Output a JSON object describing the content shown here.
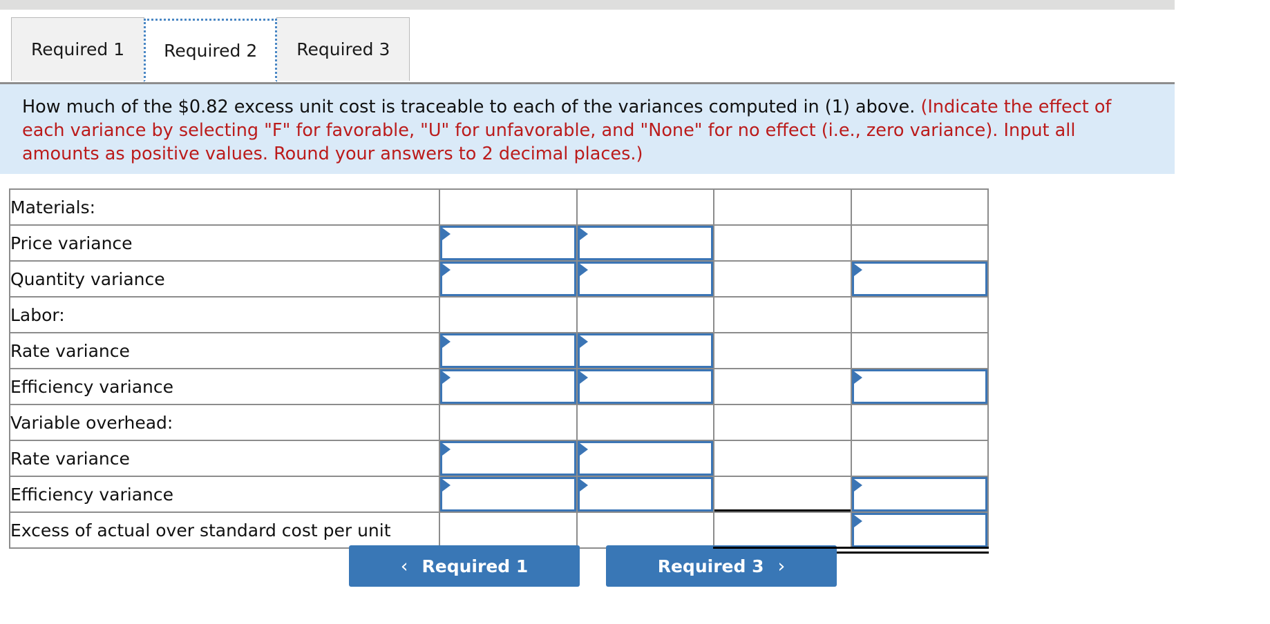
{
  "tabs": [
    {
      "label": "Required 1",
      "active": false
    },
    {
      "label": "Required 2",
      "active": true
    },
    {
      "label": "Required 3",
      "active": false
    }
  ],
  "instructions": {
    "black_part": "How much of the $0.82 excess unit cost is traceable to each of the variances computed in (1) above.",
    "red_part": "(Indicate the effect of each variance by selecting \"F\" for favorable, \"U\" for unfavorable, and \"None\" for no effect (i.e., zero variance). Input all amounts as positive values. Round your answers to 2 decimal places.)"
  },
  "table": {
    "rows": [
      {
        "label": "Materials:",
        "indent": false,
        "inputs": [
          false,
          false,
          false,
          false
        ],
        "rule": "none"
      },
      {
        "label": "Price variance",
        "indent": true,
        "inputs": [
          true,
          true,
          false,
          false
        ],
        "rule": "none"
      },
      {
        "label": "Quantity variance",
        "indent": true,
        "inputs": [
          true,
          true,
          false,
          true
        ],
        "rule": "single12"
      },
      {
        "label": "Labor:",
        "indent": false,
        "inputs": [
          false,
          false,
          false,
          false
        ],
        "rule": "none"
      },
      {
        "label": "Rate variance",
        "indent": true,
        "inputs": [
          true,
          true,
          false,
          false
        ],
        "rule": "none"
      },
      {
        "label": "Efficiency variance",
        "indent": true,
        "inputs": [
          true,
          true,
          false,
          true
        ],
        "rule": "single12"
      },
      {
        "label": "Variable overhead:",
        "indent": false,
        "inputs": [
          false,
          false,
          false,
          false
        ],
        "rule": "none"
      },
      {
        "label": "Rate variance",
        "indent": true,
        "inputs": [
          true,
          true,
          false,
          false
        ],
        "rule": "none"
      },
      {
        "label": "Efficiency variance",
        "indent": true,
        "inputs": [
          true,
          true,
          false,
          true
        ],
        "rule": "single34"
      },
      {
        "label": "Excess of actual over standard cost per unit",
        "indent": false,
        "inputs": [
          false,
          false,
          false,
          true
        ],
        "rule": "double34"
      }
    ],
    "values": {
      "r1c1": "",
      "r1c2": "",
      "r1c3": "",
      "r1c4": "",
      "r2c1": "",
      "r2c2": "",
      "r2c3": "",
      "r2c4": "",
      "r4c1": "",
      "r4c2": "",
      "r4c3": "",
      "r4c4": "",
      "r5c1": "",
      "r5c2": "",
      "r5c3": "",
      "r5c4": "",
      "r7c1": "",
      "r7c2": "",
      "r7c3": "",
      "r7c4": "",
      "r8c1": "",
      "r8c2": "",
      "r8c3": "",
      "r8c4": "",
      "r9c4": ""
    }
  },
  "nav": {
    "prev": {
      "label": "Required 1",
      "chevron": "chevron-left"
    },
    "next": {
      "label": "Required 3",
      "chevron": "chevron-right"
    }
  },
  "colors": {
    "accent_blue": "#3b75b5",
    "button_blue": "#3977b6",
    "instruction_bg": "#daeaf8",
    "hint_red": "#bb1b1b",
    "tab_inactive_bg": "#f1f1f1",
    "grid_gray": "#8c8c8c",
    "top_strip_gray": "#dededd"
  }
}
